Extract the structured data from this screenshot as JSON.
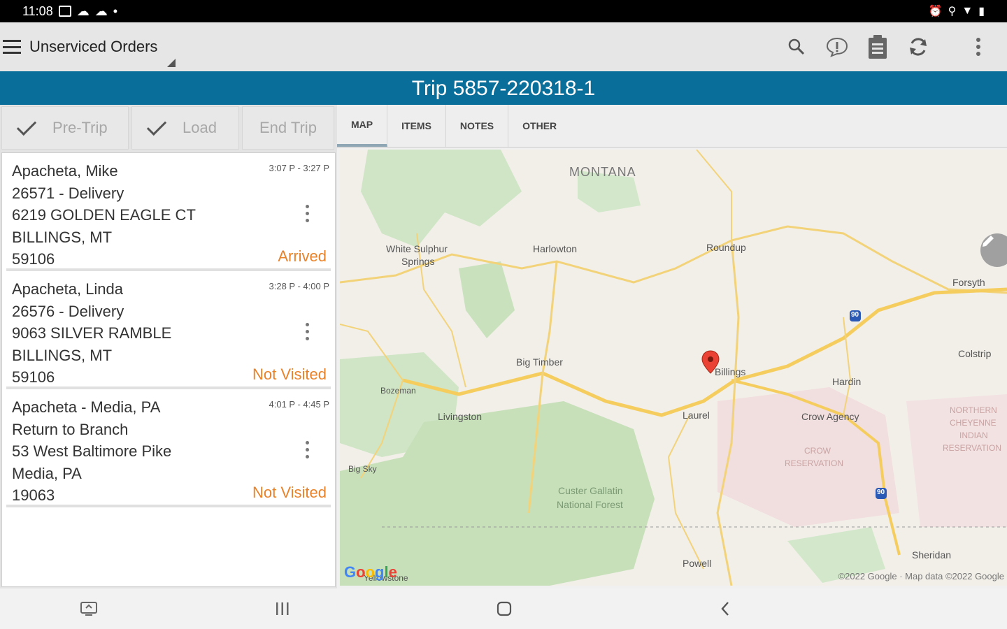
{
  "status_bar": {
    "time": "11:08",
    "dot": "•"
  },
  "app_bar": {
    "title": "Unserviced Orders",
    "icons": [
      "search-icon",
      "alert-icon",
      "clipboard-icon",
      "refresh-icon",
      "more-vert-icon"
    ]
  },
  "trip": {
    "title": "Trip 5857-220318-1"
  },
  "trip_buttons": [
    {
      "label": "Pre-Trip",
      "checked": true
    },
    {
      "label": "Load",
      "checked": true
    },
    {
      "label": "End Trip",
      "checked": false
    }
  ],
  "tabs": [
    "MAP",
    "ITEMS",
    "NOTES",
    "OTHER"
  ],
  "active_tab": "MAP",
  "orders": [
    {
      "name": "Apacheta, Mike",
      "order": "26571 - Delivery",
      "address": "6219 GOLDEN EAGLE CT",
      "city": "BILLINGS, MT",
      "zip": "59106",
      "time": "3:07 P - 3:27 P",
      "status": "Arrived"
    },
    {
      "name": "Apacheta, Linda",
      "order": "26576 - Delivery",
      "address": "9063 SILVER RAMBLE",
      "city": "BILLINGS, MT",
      "zip": "59106",
      "time": "3:28 P - 4:00 P",
      "status": "Not Visited"
    },
    {
      "name": "Apacheta - Media, PA",
      "order": "Return to Branch",
      "address": "53 West Baltimore Pike",
      "city": "Media, PA",
      "zip": "19063",
      "time": "4:01 P - 4:45 P",
      "status": "Not Visited"
    }
  ],
  "map": {
    "labels": {
      "montana": "MONTANA",
      "white_sulphur": "White Sulphur",
      "springs": "Springs",
      "harlowton": "Harlowton",
      "roundup": "Roundup",
      "forsyth": "Forsyth",
      "colstrip": "Colstrip",
      "big_timber": "Big Timber",
      "bozeman": "Bozeman",
      "livingston": "Livingston",
      "billings": "Billings",
      "hardin": "Hardin",
      "laurel": "Laurel",
      "crow_agency": "Crow Agency",
      "crow_res_1": "CROW",
      "crow_res_2": "RESERVATION",
      "northern_1": "NORTHERN",
      "northern_2": "CHEYENNE",
      "northern_3": "INDIAN",
      "northern_4": "RESERVATION",
      "big_sky": "Big Sky",
      "custer_1": "Custer Gallatin",
      "custer_2": "National Forest",
      "powell": "Powell",
      "sheridan": "Sheridan",
      "yellowstone": "Yellowstone",
      "interstate": "90"
    },
    "google": "Google",
    "copyright": "©2022 Google · Map data ©2022 Google"
  }
}
